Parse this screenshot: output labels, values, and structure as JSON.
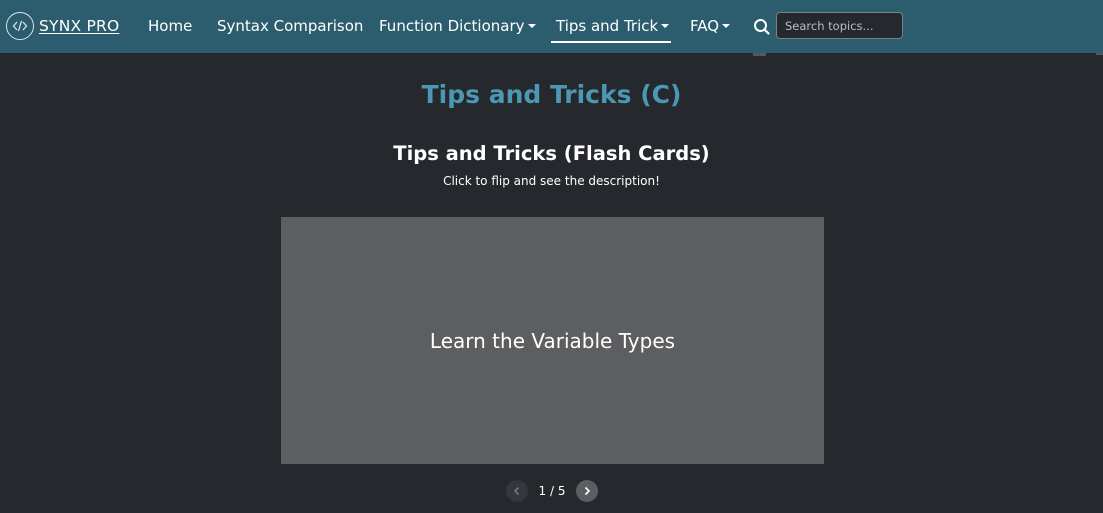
{
  "navbar": {
    "brand": "SYNX PRO",
    "items": [
      {
        "label": "Home"
      },
      {
        "label": "Syntax Comparison"
      },
      {
        "label": "Function Dictionary"
      },
      {
        "label": "Tips and Trick"
      },
      {
        "label": "FAQ"
      }
    ],
    "active_item": "Tips and Trick",
    "search": {
      "placeholder": "Search topics...",
      "value": ""
    },
    "icons": [
      "code-logo-icon",
      "search-icon"
    ]
  },
  "main": {
    "title": "Tips and Tricks (C)",
    "section_title": "Tips and Tricks (Flash Cards)",
    "section_subtitle": "Click to flip and see the description!",
    "card": {
      "front_text": "Learn the Variable Types"
    },
    "pagination": {
      "label": "1 / 5",
      "current": 1,
      "total": 5
    }
  },
  "colors": {
    "navbar_bg": "#2c5d6e",
    "page_bg": "#25282d",
    "title_accent": "#4c97b3",
    "card_bg": "#5d5e60"
  }
}
